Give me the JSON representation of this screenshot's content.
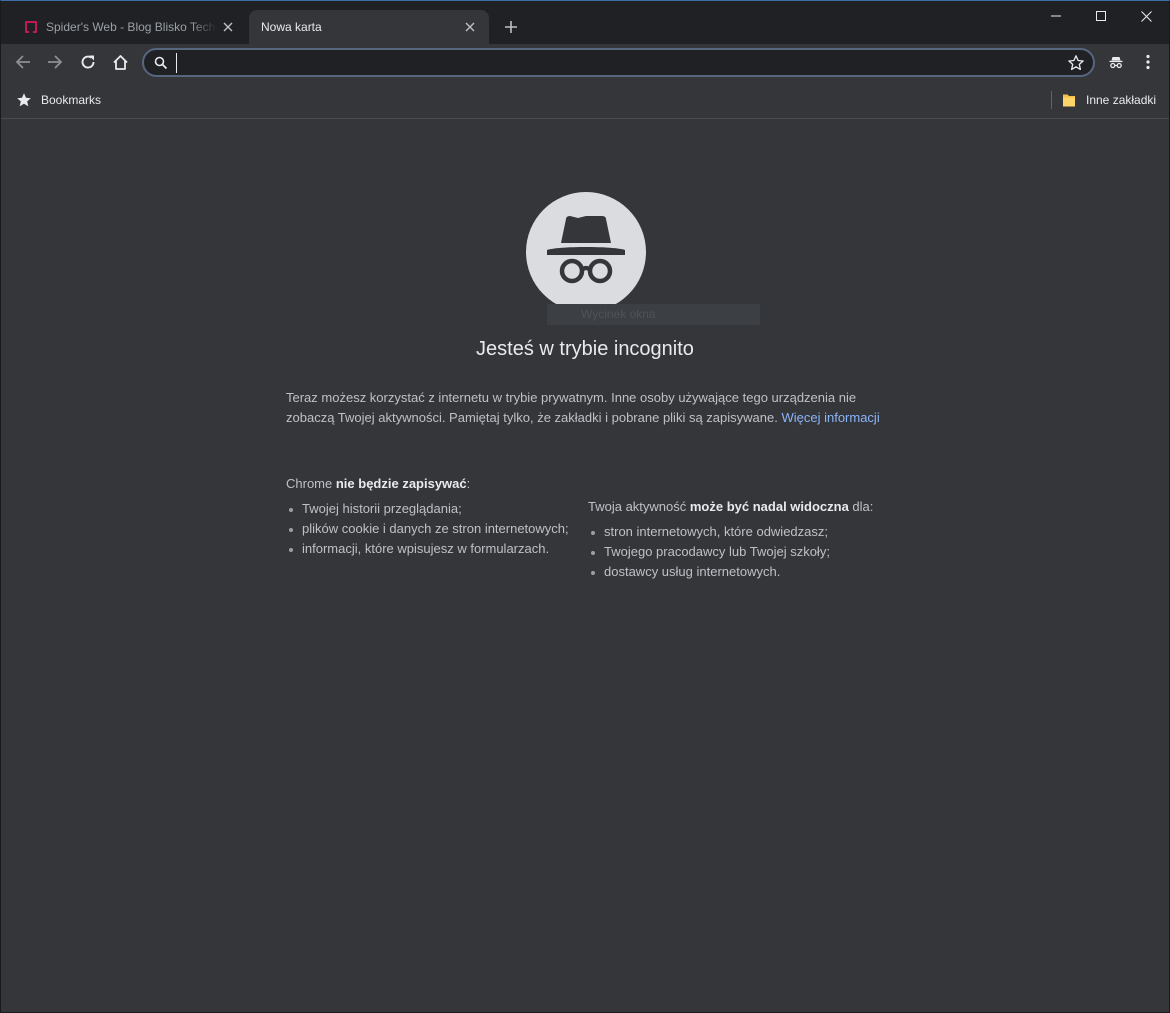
{
  "tabs": [
    {
      "title": "Spider's Web - Blog Blisko Technologii",
      "active": false
    },
    {
      "title": "Nowa karta",
      "active": true
    }
  ],
  "omnibox": {
    "value": "",
    "placeholder": ""
  },
  "bookmarks_bar": {
    "bookmarks_label": "Bookmarks",
    "other_label": "Inne zakładki"
  },
  "incognito": {
    "tooltip": "Wycinek okna",
    "heading": "Jesteś w trybie incognito",
    "intro": "Teraz możesz korzystać z internetu w trybie prywatnym. Inne osoby używające tego urządzenia nie zobaczą Twojej aktywności. Pamiętaj tylko, że zakładki i pobrane pliki są zapisywane.",
    "learn_more": "Więcej informacji",
    "not_saved": {
      "prefix": "Chrome ",
      "bold": "nie będzie zapisywać",
      "suffix": ":",
      "items": [
        "Twojej historii przeglądania;",
        "plików cookie i danych ze stron internetowych;",
        "informacji, które wpisujesz w formularzach."
      ]
    },
    "visible": {
      "prefix": "Twoja aktywność ",
      "bold": "może być nadal widoczna",
      "suffix": " dla:",
      "items": [
        "stron internetowych, które odwiedzasz;",
        "Twojego pracodawcy lub Twojej szkoły;",
        "dostawcy usług internetowych."
      ]
    }
  },
  "colors": {
    "frame": "#202124",
    "toolbar": "#35363a",
    "link": "#8ab4f8",
    "omnibox_border": "#56667f",
    "favicon": "#c2185b"
  }
}
